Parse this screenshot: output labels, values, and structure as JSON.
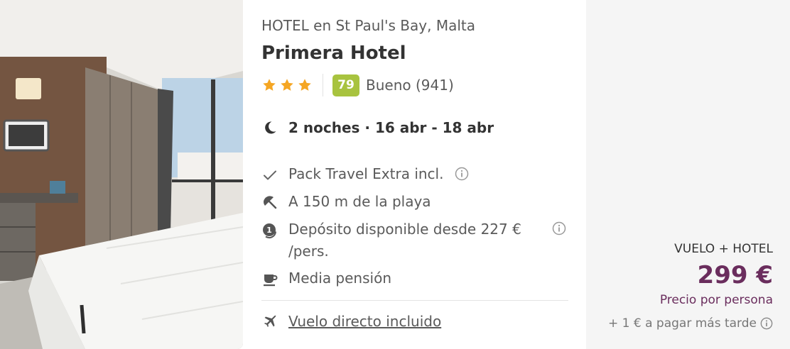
{
  "hotel": {
    "subtitle": "HOTEL en St Paul's Bay, Malta",
    "name": "Primera Hotel",
    "stars": 3,
    "score": "79",
    "score_text": "Bueno (941)",
    "nights": "2 noches · 16 abr - 18 abr",
    "features": [
      {
        "icon": "check-icon",
        "text": "Pack Travel Extra incl."
      },
      {
        "icon": "beach-umbrella-icon",
        "text": "A 150 m de la playa"
      },
      {
        "icon": "deposit-coin-icon",
        "text": "Depósito disponible desde 227 € /pers."
      },
      {
        "icon": "coffee-cup-icon",
        "text": "Media pensión"
      }
    ],
    "flight": {
      "icon": "airplane-icon",
      "text": "Vuelo directo incluido"
    }
  },
  "pricing": {
    "package_label": "VUELO + HOTEL",
    "price": "299 €",
    "per_person": "Precio por persona",
    "pay_later": "+ 1 € a pagar más tarde"
  },
  "colors": {
    "star": "#f5a623",
    "score_badge": "#a8c33f",
    "price": "#6a2d5d"
  }
}
